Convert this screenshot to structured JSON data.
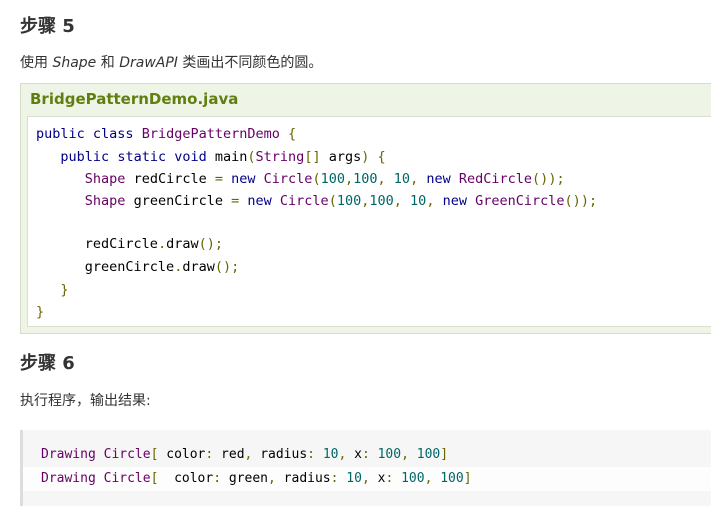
{
  "step5": {
    "title": "步骤 5",
    "desc_prefix": "使用 ",
    "desc_shape": "Shape",
    "desc_and": " 和 ",
    "desc_drawapi": "DrawAPI",
    "desc_suffix": " 类画出不同颜色的圆。"
  },
  "example": {
    "filename": "BridgePatternDemo.java",
    "code_lines": [
      "public class BridgePatternDemo {",
      "   public static void main(String[] args) {",
      "      Shape redCircle = new Circle(100,100, 10, new RedCircle());",
      "      Shape greenCircle = new Circle(100,100, 10, new GreenCircle());",
      "",
      "      redCircle.draw();",
      "      greenCircle.draw();",
      "   }",
      "}"
    ]
  },
  "step6": {
    "title": "步骤 6",
    "desc": "执行程序，输出结果:"
  },
  "output": {
    "lines": [
      "Drawing Circle[ color: red, radius: 10, x: 100, 100]",
      "Drawing Circle[  color: green, radius: 10, x: 100, 100]"
    ]
  },
  "colors": {
    "example_title": "#617f10",
    "example_bg": "#eef4e6",
    "keyword": "#000088",
    "type": "#660066",
    "literal": "#006666",
    "punctuation": "#666600"
  }
}
